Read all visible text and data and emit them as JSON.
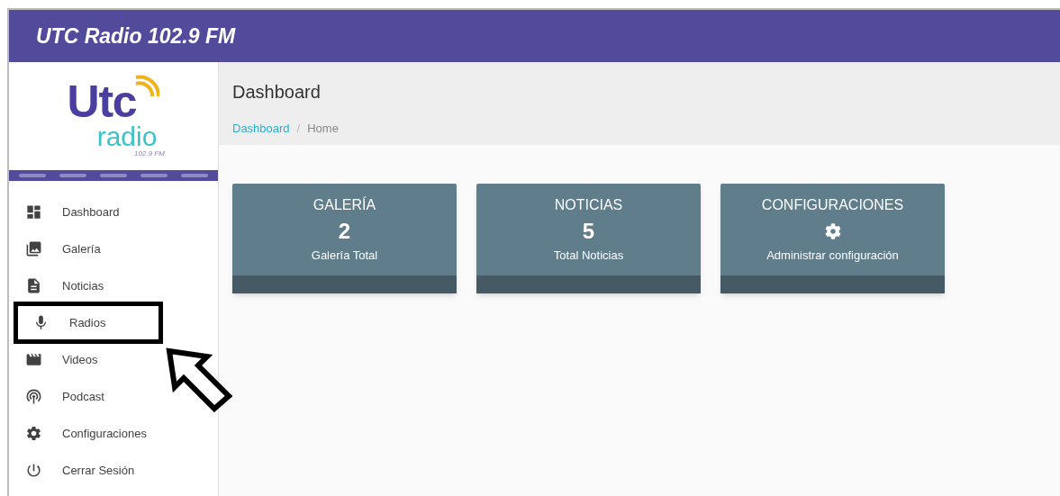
{
  "header": {
    "title": "UTC Radio 102.9 FM"
  },
  "logo": {
    "mark": "Utc",
    "word": "radio",
    "frequency": "102.9 FM"
  },
  "sidebar": {
    "items": [
      {
        "label": "Dashboard",
        "highlighted": false
      },
      {
        "label": "Galería",
        "highlighted": false
      },
      {
        "label": "Noticias",
        "highlighted": false
      },
      {
        "label": "Radios",
        "highlighted": true
      },
      {
        "label": "Videos",
        "highlighted": false
      },
      {
        "label": "Podcast",
        "highlighted": false
      },
      {
        "label": "Configuraciones",
        "highlighted": false
      },
      {
        "label": "Cerrar Sesión",
        "highlighted": false
      }
    ]
  },
  "page": {
    "title": "Dashboard",
    "breadcrumb_separator": "/",
    "breadcrumb": [
      {
        "label": "Dashboard",
        "kind": "link"
      },
      {
        "label": "Home",
        "kind": "current"
      }
    ]
  },
  "cards": [
    {
      "title": "GALERÍA",
      "kind": "count",
      "value": "2",
      "caption": "Galería Total"
    },
    {
      "title": "NOTICIAS",
      "kind": "count",
      "value": "5",
      "caption": "Total Noticias"
    },
    {
      "title": "CONFIGURACIONES",
      "kind": "icon",
      "caption": "Administrar configuración"
    }
  ]
}
